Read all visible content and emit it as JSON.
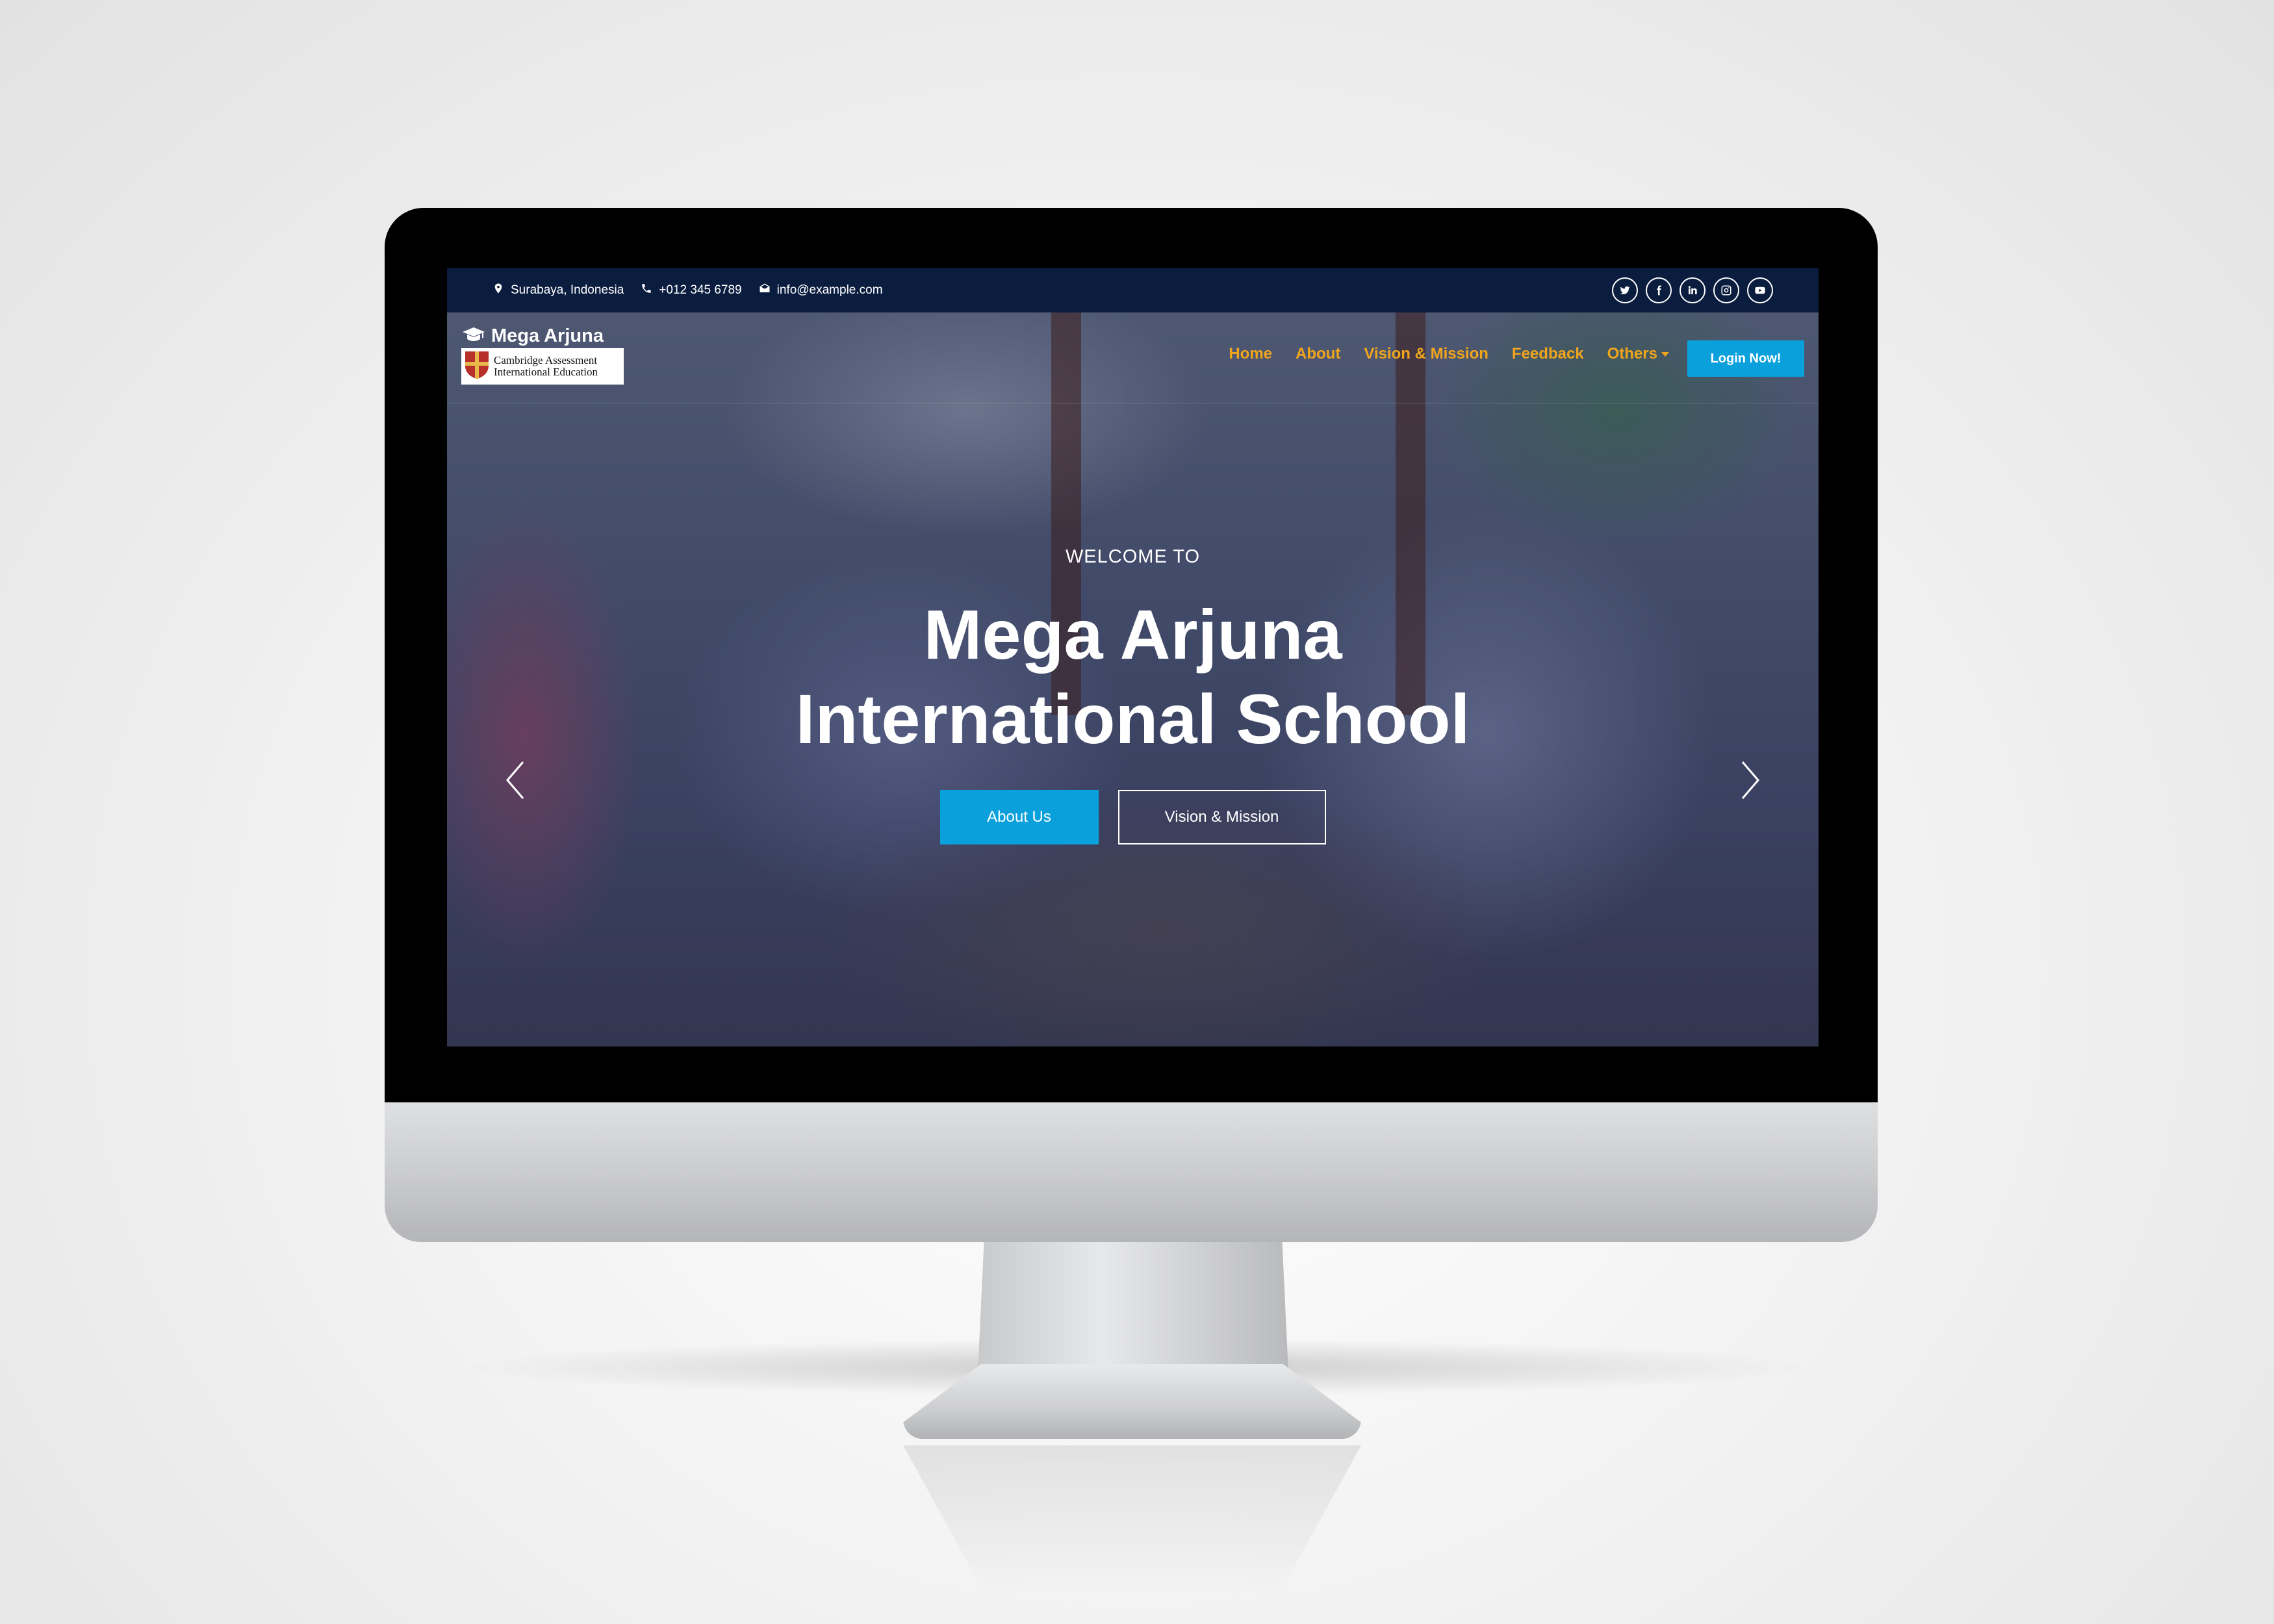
{
  "topbar": {
    "location": "Surabaya, Indonesia",
    "phone": "+012 345 6789",
    "email": "info@example.com",
    "socials": [
      "twitter-icon",
      "facebook-icon",
      "linkedin-icon",
      "instagram-icon",
      "youtube-icon"
    ]
  },
  "logo": {
    "name": "Mega Arjuna",
    "badge_line1": "Cambridge Assessment",
    "badge_line2": "International Education"
  },
  "nav": {
    "items": [
      {
        "label": "Home"
      },
      {
        "label": "About"
      },
      {
        "label": "Vision & Mission"
      },
      {
        "label": "Feedback"
      },
      {
        "label": "Others"
      }
    ],
    "login_label": "Login Now!"
  },
  "hero": {
    "eyebrow": "WELCOME TO",
    "title_line1": "Mega Arjuna",
    "title_line2": "International School",
    "primary_cta": "About Us",
    "secondary_cta": "Vision & Mission"
  },
  "colors": {
    "accent": "#0aa0dc",
    "nav_link": "#f0a51c",
    "topbar": "#0b1d3f"
  }
}
